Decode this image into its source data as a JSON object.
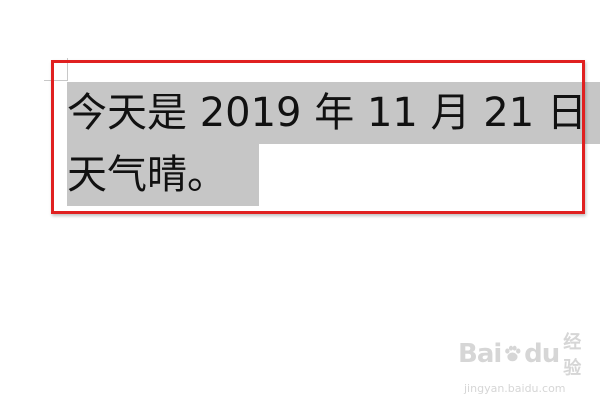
{
  "document": {
    "lines": [
      "今天是 2019 年 11 月 21 日",
      "天气晴。"
    ]
  },
  "watermark": {
    "brand_left": "Bai",
    "brand_right": "du",
    "suffix": "经验",
    "url": "jingyan.baidu.com",
    "icon": "paw-icon"
  },
  "colors": {
    "highlight_border": "#e02020",
    "selection": "#c6c6c6",
    "watermark": "#d6d6d6"
  }
}
